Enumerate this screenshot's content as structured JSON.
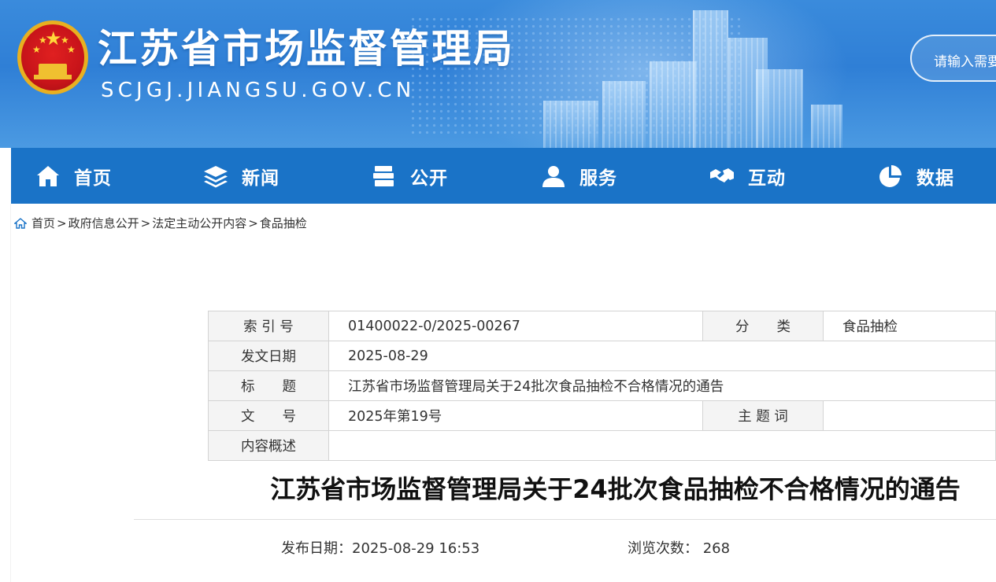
{
  "header": {
    "site_title": "江苏省市场监督管理局",
    "site_domain": "SCJGJ.JIANGSU.GOV.CN",
    "search_placeholder": "请输入需要"
  },
  "nav": {
    "items": [
      {
        "label": "首页",
        "icon": "home-icon"
      },
      {
        "label": "新闻",
        "icon": "layers-icon"
      },
      {
        "label": "公开",
        "icon": "document-stack-icon"
      },
      {
        "label": "服务",
        "icon": "user-icon"
      },
      {
        "label": "互动",
        "icon": "handshake-icon"
      },
      {
        "label": "数据",
        "icon": "pie-chart-icon"
      }
    ]
  },
  "breadcrumb": {
    "items": [
      "首页",
      "政府信息公开",
      "法定主动公开内容",
      "食品抽检"
    ],
    "separator": ">"
  },
  "info": {
    "index_label": "索 引 号",
    "index_value": "01400022-0/2025-00267",
    "category_label": "分　　类",
    "category_value": "食品抽检",
    "date_label": "发文日期",
    "date_value": "2025-08-29",
    "title_label": "标　　题",
    "title_value": "江苏省市场监督管理局关于24批次食品抽检不合格情况的通告",
    "docno_label": "文　　号",
    "docno_value": "2025年第19号",
    "keywords_label": "主 题 词",
    "keywords_value": "",
    "summary_label": "内容概述",
    "summary_value": ""
  },
  "article": {
    "title": "江苏省市场监督管理局关于24批次食品抽检不合格情况的通告",
    "publish_label": "发布日期：",
    "publish_value": "2025-08-29 16:53",
    "views_label": "浏览次数：",
    "views_value": "268"
  },
  "colors": {
    "nav_bg": "#1a73c7",
    "header_bg": "#2f7fd6",
    "table_key_bg": "#f4f4f4",
    "table_border": "#d4d4d4"
  }
}
